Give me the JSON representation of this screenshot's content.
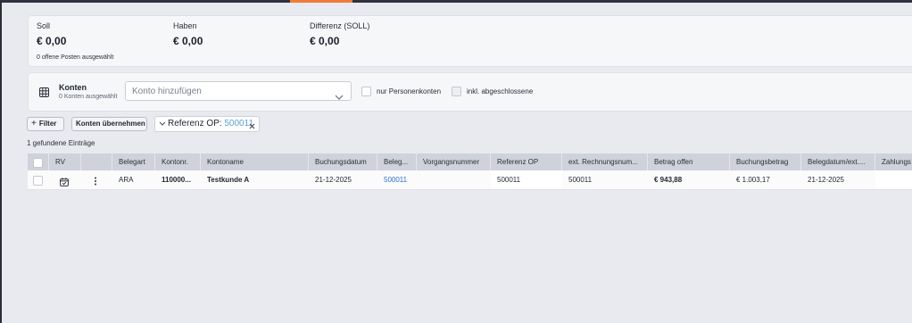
{
  "summary": {
    "soll_label": "Soll",
    "soll_value": "€ 0,00",
    "haben_label": "Haben",
    "haben_value": "€ 0,00",
    "diff_label": "Differenz (SOLL)",
    "diff_value": "€ 0,00",
    "note": "0 offene Posten ausgewählt"
  },
  "accounts": {
    "title": "Konten",
    "subtitle": "0 Konten ausgewählt",
    "select_placeholder": "Konto hinzufügen",
    "only_persons_label": "nur Personenkonten",
    "include_closed_label": "inkl. abgeschlossene"
  },
  "toolbar": {
    "filter_label": "Filter",
    "apply_accounts_label": "Konten übernehmen",
    "chip_key": "Referenz OP:",
    "chip_value": "500011"
  },
  "results_text": "1 gefundene Einträge",
  "table": {
    "columns": [
      "RV",
      "Belegart",
      "Kontonr.",
      "Kontoname",
      "Buchungsdatum",
      "Beleg...",
      "Vorgangsnummer",
      "Referenz OP",
      "ext. Rechnungsnum...",
      "Betrag offen",
      "Buchungsbetrag",
      "Belegdatum/ext....",
      "Zahlungs"
    ],
    "row": {
      "belegart": "ARA",
      "kontonr": "110000...",
      "kontoname": "Testkunde A",
      "buchungsdatum": "21-12-2025",
      "beleg": "500011",
      "vorgangsnummer": "",
      "referenz_op": "500011",
      "ext_rechnungsnummer": "500011",
      "betrag_offen": "€ 943,88",
      "buchungsbetrag": "€ 1.003,17",
      "belegdatum": "21-12-2025",
      "zahlungs": ""
    }
  },
  "colors": {
    "accent": "#f07a3a",
    "link": "#2f6fd1",
    "chip_value": "#5aa0d6"
  }
}
